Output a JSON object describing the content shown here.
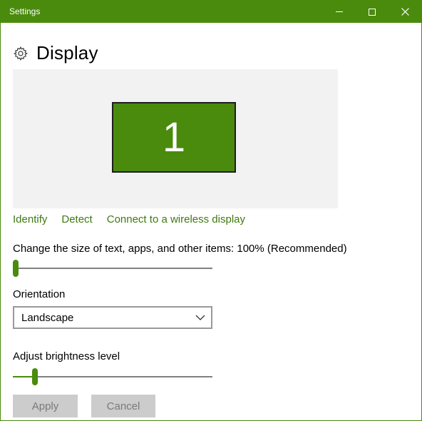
{
  "window": {
    "title": "Settings"
  },
  "page": {
    "title": "Display"
  },
  "display_preview": {
    "monitor_number": "1"
  },
  "links": {
    "identify": "Identify",
    "detect": "Detect",
    "wireless": "Connect to a wireless display"
  },
  "scale": {
    "label": "Change the size of text, apps, and other items: 100% (Recommended)",
    "value_fraction": 0.0
  },
  "orientation": {
    "label": "Orientation",
    "value": "Landscape"
  },
  "brightness": {
    "label": "Adjust brightness level",
    "value_fraction": 0.1
  },
  "buttons": {
    "apply": "Apply",
    "cancel": "Cancel"
  },
  "colors": {
    "accent": "#4a8b0d",
    "link": "#3f7a10",
    "preview_bg": "#f2f2f2"
  },
  "icons": {
    "settings": "gear-icon",
    "minimize": "minimize-icon",
    "maximize": "maximize-icon",
    "close": "close-icon",
    "dropdown": "chevron-down-icon"
  }
}
